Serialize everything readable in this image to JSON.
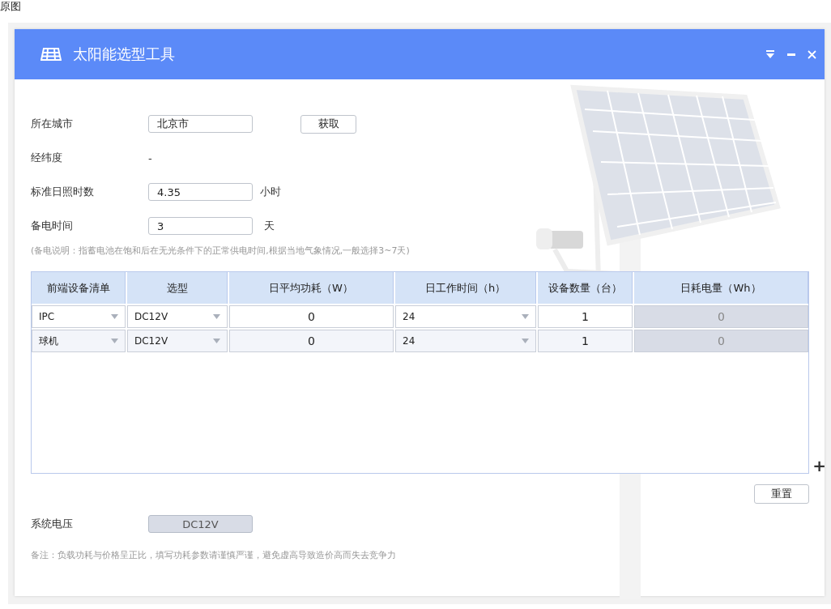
{
  "page_caption": "原图",
  "window": {
    "title": "太阳能选型工具"
  },
  "form": {
    "city": {
      "label": "所在城市",
      "value": "北京市",
      "button": "获取"
    },
    "coords": {
      "label": "经纬度",
      "value": "-"
    },
    "sun_hours": {
      "label": "标准日照时数",
      "value": "4.35",
      "unit": "小时"
    },
    "backup": {
      "label": "备电时间",
      "value": "3",
      "unit": "天"
    },
    "backup_note": "(备电说明：指蓄电池在饱和后在无光条件下的正常供电时间,根据当地气象情况,一般选择3~7天)"
  },
  "table": {
    "columns": [
      "前端设备清单",
      "选型",
      "日平均功耗（W）",
      "日工作时间（h）",
      "设备数量（台）",
      "日耗电量（Wh）"
    ],
    "rows": [
      {
        "cells": [
          {
            "kind": "select",
            "value": "IPC"
          },
          {
            "kind": "select",
            "value": "DC12V"
          },
          {
            "kind": "input",
            "value": "0"
          },
          {
            "kind": "select",
            "value": "24"
          },
          {
            "kind": "input",
            "value": "1"
          },
          {
            "kind": "readonly",
            "value": "0"
          }
        ]
      },
      {
        "cells": [
          {
            "kind": "select",
            "value": "球机"
          },
          {
            "kind": "select",
            "value": "DC12V"
          },
          {
            "kind": "input",
            "value": "0"
          },
          {
            "kind": "select",
            "value": "24"
          },
          {
            "kind": "input",
            "value": "1"
          },
          {
            "kind": "readonly",
            "value": "0"
          }
        ]
      }
    ]
  },
  "add_button": "+",
  "reset_button": "重置",
  "system_voltage": {
    "label": "系统电压",
    "value": "DC12V"
  },
  "footnote": "备注：负载功耗与价格呈正比，填写功耗参数请谨慎严谨，避免虚高导致造价高而失去竞争力"
}
